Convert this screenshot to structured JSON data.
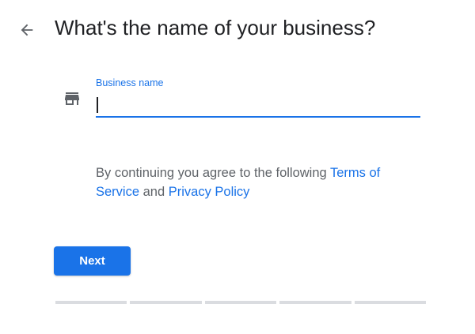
{
  "header": {
    "back_icon": "arrow-back-icon",
    "title": "What's the name of your business?"
  },
  "form": {
    "store_icon": "storefront-icon",
    "business_name_label": "Business name",
    "business_name_value": "",
    "focused": true
  },
  "terms": {
    "prefix": "By continuing you agree to the following ",
    "terms_link": "Terms of Service",
    "conjunction": " and ",
    "privacy_link": "Privacy Policy"
  },
  "actions": {
    "next_label": "Next"
  },
  "progress": {
    "total_steps": 5,
    "completed_steps": 0
  },
  "colors": {
    "accent": "#1a73e8",
    "text_primary": "#202124",
    "text_secondary": "#5f6368",
    "progress_track": "#dadce0"
  }
}
